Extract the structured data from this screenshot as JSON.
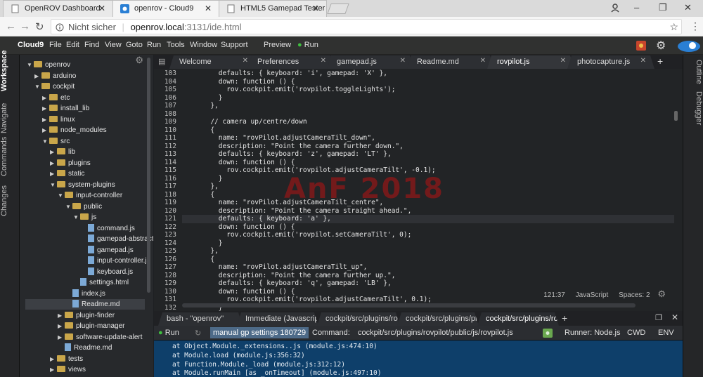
{
  "browser": {
    "tabs": [
      {
        "title": "OpenROV Dashboard"
      },
      {
        "title": "openrov - Cloud9"
      },
      {
        "title": "HTML5 Gamepad Tester"
      }
    ],
    "address": {
      "security": "Nicht sicher",
      "host": "openrov.local",
      "rest": ":3131/ide.html"
    }
  },
  "menubar": {
    "brand": "Cloud9",
    "items": [
      "File",
      "Edit",
      "Find",
      "View",
      "Goto",
      "Run",
      "Tools",
      "Window",
      "Support"
    ],
    "preview": "Preview",
    "run": "Run"
  },
  "left_panel": [
    "Workspace",
    "Navigate",
    "Commands",
    "Changes"
  ],
  "right_panel": [
    "Outline",
    "Debugger"
  ],
  "tree": [
    {
      "label": "openrov",
      "indent": 0,
      "type": "folder",
      "open": true
    },
    {
      "label": "arduino",
      "indent": 1,
      "type": "folder",
      "open": false
    },
    {
      "label": "cockpit",
      "indent": 1,
      "type": "folder",
      "open": true
    },
    {
      "label": "etc",
      "indent": 2,
      "type": "folder",
      "open": false
    },
    {
      "label": "install_lib",
      "indent": 2,
      "type": "folder",
      "open": false
    },
    {
      "label": "linux",
      "indent": 2,
      "type": "folder",
      "open": false
    },
    {
      "label": "node_modules",
      "indent": 2,
      "type": "folder",
      "open": false
    },
    {
      "label": "src",
      "indent": 2,
      "type": "folder",
      "open": true
    },
    {
      "label": "lib",
      "indent": 3,
      "type": "folder",
      "open": false
    },
    {
      "label": "plugins",
      "indent": 3,
      "type": "folder",
      "open": false
    },
    {
      "label": "static",
      "indent": 3,
      "type": "folder",
      "open": false
    },
    {
      "label": "system-plugins",
      "indent": 3,
      "type": "folder",
      "open": true
    },
    {
      "label": "input-controller",
      "indent": 4,
      "type": "folder",
      "open": true
    },
    {
      "label": "public",
      "indent": 5,
      "type": "folder",
      "open": true
    },
    {
      "label": "js",
      "indent": 6,
      "type": "folder",
      "open": true
    },
    {
      "label": "command.js",
      "indent": 7,
      "type": "file"
    },
    {
      "label": "gamepad-abstraction.js",
      "indent": 7,
      "type": "file"
    },
    {
      "label": "gamepad.js",
      "indent": 7,
      "type": "file"
    },
    {
      "label": "input-controller.js",
      "indent": 7,
      "type": "file"
    },
    {
      "label": "keyboard.js",
      "indent": 7,
      "type": "file"
    },
    {
      "label": "settings.html",
      "indent": 6,
      "type": "file"
    },
    {
      "label": "index.js",
      "indent": 5,
      "type": "file"
    },
    {
      "label": "Readme.md",
      "indent": 5,
      "type": "file",
      "selected": true
    },
    {
      "label": "plugin-finder",
      "indent": 4,
      "type": "folder",
      "open": false
    },
    {
      "label": "plugin-manager",
      "indent": 4,
      "type": "folder",
      "open": false
    },
    {
      "label": "software-update-alert",
      "indent": 4,
      "type": "folder",
      "open": false
    },
    {
      "label": "Readme.md",
      "indent": 4,
      "type": "file"
    },
    {
      "label": "tests",
      "indent": 3,
      "type": "folder",
      "open": false
    },
    {
      "label": "views",
      "indent": 3,
      "type": "folder",
      "open": false
    }
  ],
  "editor_tabs": [
    "Welcome",
    "Preferences",
    "gamepad.js",
    "Readme.md",
    "rovpilot.js",
    "photocapture.js"
  ],
  "active_editor_tab": 4,
  "code": [
    {
      "n": "103",
      "t": "        defaults: { keyboard: 'i', gamepad: 'X' },"
    },
    {
      "n": "104",
      "t": "        down: function () {"
    },
    {
      "n": "105",
      "t": "          rov.cockpit.emit('rovpilot.toggleLights');"
    },
    {
      "n": "106",
      "t": "        }"
    },
    {
      "n": "107",
      "t": "      },"
    },
    {
      "n": "108",
      "t": ""
    },
    {
      "n": "109",
      "t": "      // camera up/centre/down"
    },
    {
      "n": "110",
      "t": "      {"
    },
    {
      "n": "111",
      "t": "        name: \"rovPilot.adjustCameraTilt_down\","
    },
    {
      "n": "112",
      "t": "        description: \"Point the camera further down.\","
    },
    {
      "n": "113",
      "t": "        defaults: { keyboard: 'z', gamepad: 'LT' },"
    },
    {
      "n": "114",
      "t": "        down: function () {"
    },
    {
      "n": "115",
      "t": "          rov.cockpit.emit('rovpilot.adjustCameraTilt', -0.1);"
    },
    {
      "n": "116",
      "t": "        }"
    },
    {
      "n": "117",
      "t": "      },"
    },
    {
      "n": "118",
      "t": "      {"
    },
    {
      "n": "119",
      "t": "        name: \"rovPilot.adjustCameraTilt_centre\","
    },
    {
      "n": "120",
      "t": "        description: \"Point the camera straight ahead.\","
    },
    {
      "n": "121",
      "t": "        defaults: { keyboard: 'a' },"
    },
    {
      "n": "122",
      "t": "        down: function () {"
    },
    {
      "n": "123",
      "t": "          rov.cockpit.emit('rovpilot.setCameraTilt', 0);"
    },
    {
      "n": "124",
      "t": "        }"
    },
    {
      "n": "125",
      "t": "      },"
    },
    {
      "n": "126",
      "t": "      {"
    },
    {
      "n": "127",
      "t": "        name: \"rovPilot.adjustCameraTilt_up\","
    },
    {
      "n": "128",
      "t": "        description: \"Point the camera further up.\","
    },
    {
      "n": "129",
      "t": "        defaults: { keyboard: 'q', gamepad: 'LB' },"
    },
    {
      "n": "130",
      "t": "        down: function () {"
    },
    {
      "n": "131",
      "t": "          rov.cockpit.emit('rovpilot.adjustCameraTilt', 0.1);"
    },
    {
      "n": "132",
      "t": "        }"
    }
  ],
  "highlight_line": "121",
  "watermark": "AnF 2018",
  "status": {
    "cursor": "121:37",
    "language": "JavaScript",
    "spaces": "Spaces: 2"
  },
  "terminal_tabs": [
    "bash - \"openrov\"",
    "Immediate (Javascript)",
    "cockpit/src/plugins/rovpilot",
    "cockpit/src/plugins/photocapture",
    "cockpit/src/plugins/rovpilot/public"
  ],
  "runbar": {
    "run": "Run",
    "field": "manual gp settings 180729",
    "command_label": "Command:",
    "command": "cockpit/src/plugins/rovpilot/public/js/rovpilot.js",
    "runner": "Runner: Node.js",
    "cwd": "CWD",
    "env": "ENV"
  },
  "terminal": [
    "at Object.Module._extensions..js (module.js:474:10)",
    "at Module.load (module.js:356:32)",
    "at Function.Module._load (module.js:312:12)",
    "at Module.runMain [as _onTimeout] (module.js:497:10)"
  ],
  "colors": {
    "accent": "#2a7fd4",
    "terminal_bg": "#0e3f6a",
    "run_green": "#3fbf3f"
  }
}
